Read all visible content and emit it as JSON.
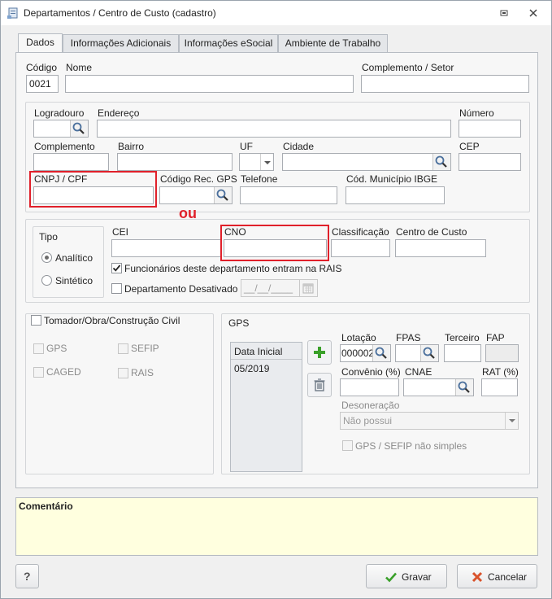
{
  "window": {
    "title": "Departamentos / Centro de Custo (cadastro)",
    "colors": {
      "highlight_red": "#e0202a",
      "comment_bg": "#ffffdf",
      "add_green": "#3aa02a",
      "cancel_red": "#d9532c"
    }
  },
  "tabs": [
    "Dados",
    "Informações Adicionais",
    "Informações eSocial",
    "Ambiente de Trabalho"
  ],
  "active_tab": "Dados",
  "header": {
    "codigo_label": "Código",
    "codigo_value": "0021",
    "nome_label": "Nome",
    "nome_value": "",
    "complemento_setor_label": "Complemento / Setor",
    "complemento_setor_value": ""
  },
  "address": {
    "logradouro_label": "Logradouro",
    "endereco_label": "Endereço",
    "numero_label": "Número",
    "complemento_label": "Complemento",
    "bairro_label": "Bairro",
    "uf_label": "UF",
    "cidade_label": "Cidade",
    "cep_label": "CEP",
    "cnpj_cpf_label": "CNPJ / CPF",
    "codigo_rec_gps_label": "Código Rec. GPS",
    "telefone_label": "Telefone",
    "cod_municipio_label": "Cód. Município IBGE"
  },
  "annotation_ou": "ou",
  "tipo": {
    "group_label": "Tipo",
    "options": [
      "Analítico",
      "Sintético"
    ],
    "selected": "Analítico"
  },
  "registration": {
    "cei_label": "CEI",
    "cno_label": "CNO",
    "classificacao_label": "Classificação",
    "centro_custo_label": "Centro de Custo",
    "rais_checkbox_label": "Funcionários deste departamento entram na RAIS",
    "rais_checked": true,
    "desativado_label": "Departamento Desativado",
    "desativado_checked": false,
    "desativado_date_placeholder": "__/__/____"
  },
  "tomador": {
    "checkbox_label": "Tomador/Obra/Construção Civil",
    "checked": false,
    "options": [
      "GPS",
      "SEFIP",
      "CAGED",
      "RAIS"
    ]
  },
  "gps": {
    "group_label": "GPS",
    "list_header": "Data Inicial",
    "list_rows": [
      "05/2019"
    ],
    "lotacao_label": "Lotação",
    "lotacao_value": "000002",
    "fpas_label": "FPAS",
    "terceiro_label": "Terceiro",
    "fap_label": "FAP",
    "convenio_label": "Convênio (%)",
    "cnae_label": "CNAE",
    "rat_label": "RAT (%)",
    "desoneracao_label": "Desoneração",
    "desoneracao_value": "Não possui",
    "gps_sefip_label": "GPS / SEFIP não simples"
  },
  "comment": {
    "label": "Comentário"
  },
  "footer": {
    "help_label": "?",
    "gravar_label": "Gravar",
    "cancelar_label": "Cancelar"
  }
}
